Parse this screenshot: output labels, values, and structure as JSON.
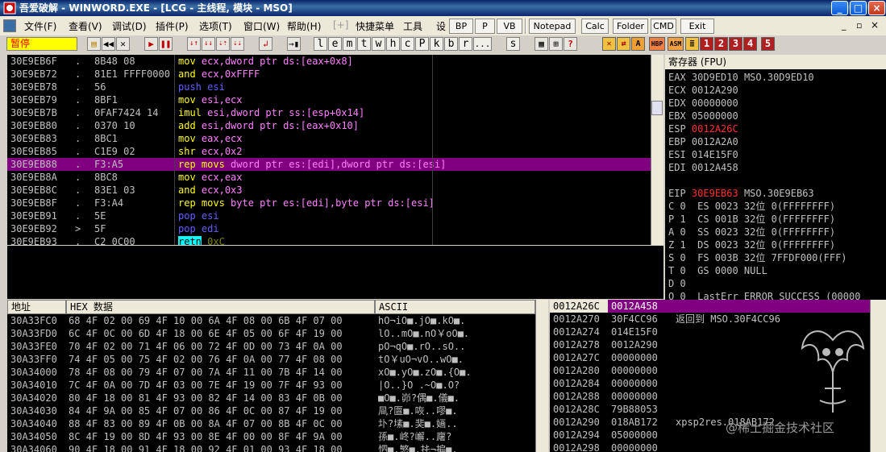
{
  "window": {
    "title": "吾爱破解 - WINWORD.EXE - [LCG - 主线程, 模块 - MSO]",
    "controls": [
      "_",
      "□",
      "×"
    ]
  },
  "menubar": {
    "menus": [
      "文件(F)",
      "查看(V)",
      "调试(D)",
      "插件(P)",
      "选项(T)",
      "窗口(W)",
      "帮助(H)",
      "[+]",
      "快捷菜单",
      "工具",
      "设"
    ],
    "quick_buttons": [
      "BP",
      "P",
      "VB",
      "Notepad",
      "Calc",
      "Folder",
      "CMD",
      "Exit"
    ]
  },
  "toolbar": {
    "status": "暂停",
    "letter_buttons": [
      "l",
      "e",
      "m",
      "t",
      "w",
      "h",
      "c",
      "P",
      "k",
      "b",
      "r",
      "...",
      "s"
    ],
    "plugin_labels": [
      "HBP",
      "ASM",
      "1",
      "2",
      "3",
      "4",
      "5"
    ]
  },
  "disasm": {
    "rows": [
      {
        "addr": "30E9EB6F",
        "mark": ".",
        "hex": "8B48 08",
        "mn": "mov",
        "ops": "ecx,dword ptr ds:[eax+0x8]"
      },
      {
        "addr": "30E9EB72",
        "mark": ".",
        "hex": "81E1 FFFF0000",
        "mn": "and",
        "ops": "ecx,0xFFFF"
      },
      {
        "addr": "30E9EB78",
        "mark": ".",
        "hex": "56",
        "mn": "push",
        "ops": "esi"
      },
      {
        "addr": "30E9EB79",
        "mark": ".",
        "hex": "8BF1",
        "mn": "mov",
        "ops": "esi,ecx"
      },
      {
        "addr": "30E9EB7B",
        "mark": ".",
        "hex": "0FAF7424 14",
        "mn": "imul",
        "ops": "esi,dword ptr ss:[esp+0x14]"
      },
      {
        "addr": "30E9EB80",
        "mark": ".",
        "hex": "0370 10",
        "mn": "add",
        "ops": "esi,dword ptr ds:[eax+0x10]"
      },
      {
        "addr": "30E9EB83",
        "mark": ".",
        "hex": "8BC1",
        "mn": "mov",
        "ops": "eax,ecx"
      },
      {
        "addr": "30E9EB85",
        "mark": ".",
        "hex": "C1E9 02",
        "mn": "shr",
        "ops": "ecx,0x2"
      },
      {
        "addr": "30E9EB88",
        "mark": ".",
        "hex": "F3:A5",
        "mn": "rep movs",
        "ops": "dword ptr es:[edi],dword ptr ds:[esi]",
        "selected": true
      },
      {
        "addr": "30E9EB8A",
        "mark": ".",
        "hex": "8BC8",
        "mn": "mov",
        "ops": "ecx,eax"
      },
      {
        "addr": "30E9EB8C",
        "mark": ".",
        "hex": "83E1 03",
        "mn": "and",
        "ops": "ecx,0x3"
      },
      {
        "addr": "30E9EB8F",
        "mark": ".",
        "hex": "F3:A4",
        "mn": "rep movs",
        "ops": "byte ptr es:[edi],byte ptr ds:[esi]"
      },
      {
        "addr": "30E9EB91",
        "mark": ".",
        "hex": "5E",
        "mn": "pop",
        "ops": "esi"
      },
      {
        "addr": "30E9EB92",
        "mark": ">",
        "hex": "5F",
        "mn": "pop",
        "ops": "edi"
      },
      {
        "addr": "30E9EB93",
        "mark": ".",
        "hex": "C2 0C00",
        "mn": "retn",
        "ops": "0xC"
      }
    ]
  },
  "registers": {
    "title": "寄存器 (FPU)",
    "rows": [
      {
        "name": "EAX",
        "val": "30D9ED10",
        "extra": "MSO.30D9ED10"
      },
      {
        "name": "ECX",
        "val": "0012A290",
        "extra": ""
      },
      {
        "name": "EDX",
        "val": "00000000",
        "extra": ""
      },
      {
        "name": "EBX",
        "val": "05000000",
        "extra": ""
      },
      {
        "name": "ESP",
        "val": "0012A26C",
        "extra": "",
        "changed": true
      },
      {
        "name": "EBP",
        "val": "0012A2A0",
        "extra": ""
      },
      {
        "name": "ESI",
        "val": "014E15F0",
        "extra": ""
      },
      {
        "name": "EDI",
        "val": "0012A458",
        "extra": ""
      },
      {
        "name": "EIP",
        "val": "30E9EB63",
        "extra": "MSO.30E9EB63",
        "changed": true
      }
    ],
    "flags": [
      "C 0  ES 0023 32位 0(FFFFFFFF)",
      "P 1  CS 001B 32位 0(FFFFFFFF)",
      "A 0  SS 0023 32位 0(FFFFFFFF)",
      "Z 1  DS 0023 32位 0(FFFFFFFF)",
      "S 0  FS 003B 32位 7FFDF000(FFF)",
      "T 0  GS 0000 NULL",
      "D 0",
      "O 0  LastErr ERROR_SUCCESS (00000"
    ]
  },
  "dump": {
    "headers": {
      "addr": "地址",
      "hex": "HEX 数据",
      "ascii": "ASCII"
    },
    "rows": [
      {
        "addr": "30A33FC0",
        "hex": "68 4F 02 00 69 4F 10 00 6A 4F 08 00 6B 4F 07 00",
        "ascii": "hO¬iO■.jO■.kO■."
      },
      {
        "addr": "30A33FD0",
        "hex": "6C 4F 0C 00 6D 4F 18 00 6E 4F 05 00 6F 4F 19 00",
        "ascii": "lO..mO■.nO￥oO■."
      },
      {
        "addr": "30A33FE0",
        "hex": "70 4F 02 00 71 4F 06 00 72 4F 0D 00 73 4F 0A 00",
        "ascii": "pO¬qO■.rO..sO.."
      },
      {
        "addr": "30A33FF0",
        "hex": "74 4F 05 00 75 4F 02 00 76 4F 0A 00 77 4F 08 00",
        "ascii": "tO￥uO¬vO..wO■."
      },
      {
        "addr": "30A34000",
        "hex": "78 4F 08 00 79 4F 07 00 7A 4F 11 00 7B 4F 14 00",
        "ascii": "xO■.yO■.zO■.{O■."
      },
      {
        "addr": "30A34010",
        "hex": "7C 4F 0A 00 7D 4F 03 00 7E 4F 19 00 7F 4F 93 00",
        "ascii": "|O..}O .~O■.O?"
      },
      {
        "addr": "30A34020",
        "hex": "80 4F 18 00 81 4F 93 00 82 4F 14 00 83 4F 0B 00",
        "ascii": "■O■.峁?偶■.儀■."
      },
      {
        "addr": "30A34030",
        "hex": "84 4F 9A 00 85 4F 07 00 86 4F 0C 00 87 4F 19 00",
        "ascii": "凬?匫■.咴..嘐■."
      },
      {
        "addr": "30A34040",
        "hex": "88 4F 83 00 89 4F 0B 00 8A 4F 07 00 8B 4F 0C 00",
        "ascii": "圤?塐■.奜■.婳.."
      },
      {
        "addr": "30A34050",
        "hex": "8C 4F 19 00 8D 4F 93 00 8E 4F 00 00 8F 4F 9A 00",
        "ascii": "孫■.峂?嶰..廜?"
      },
      {
        "addr": "30A34060",
        "hex": "90 4F 18 00 91 4F 18 00 92 4F 01 00 93 4F 18 00",
        "ascii": "怬■.慜■.扥¬揙■."
      }
    ]
  },
  "stack": {
    "header_addr": "0012A26C",
    "header_val": "0012A458",
    "rows": [
      {
        "addr": "0012A270",
        "val": "30F4CC96",
        "comment": "返回到 MSO.30F4CC96"
      },
      {
        "addr": "0012A274",
        "val": "014E15F0",
        "comment": ""
      },
      {
        "addr": "0012A278",
        "val": "0012A290",
        "comment": ""
      },
      {
        "addr": "0012A27C",
        "val": "00000000",
        "comment": ""
      },
      {
        "addr": "0012A280",
        "val": "00000000",
        "comment": ""
      },
      {
        "addr": "0012A284",
        "val": "00000000",
        "comment": ""
      },
      {
        "addr": "0012A288",
        "val": "00000000",
        "comment": ""
      },
      {
        "addr": "0012A28C",
        "val": "79B88053",
        "comment": ""
      },
      {
        "addr": "0012A290",
        "val": "018AB172",
        "comment": "xpsp2res.018AB172"
      },
      {
        "addr": "0012A294",
        "val": "05000000",
        "comment": ""
      },
      {
        "addr": "0012A298",
        "val": "00000000",
        "comment": ""
      }
    ]
  },
  "watermark": "@稀土掘金技术社区"
}
